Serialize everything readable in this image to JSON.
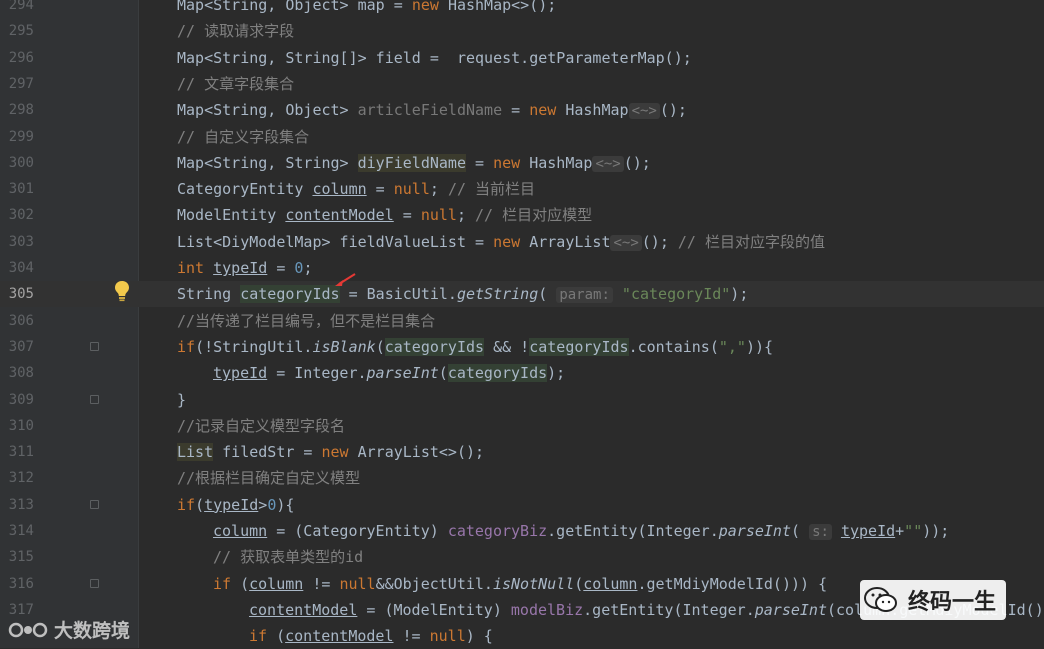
{
  "lines": [
    {
      "n": "294",
      "segs": [
        [
          "",
          "Map<String, Object> map = "
        ],
        [
          "kw",
          "new "
        ],
        [
          "",
          "HashMap<>();"
        ]
      ]
    },
    {
      "n": "295",
      "segs": [
        [
          "cm",
          "// 读取请求字段"
        ]
      ]
    },
    {
      "n": "296",
      "segs": [
        [
          "",
          "Map<String, String[]> field =  request.getParameterMap();"
        ]
      ]
    },
    {
      "n": "297",
      "segs": [
        [
          "cm",
          "// 文章字段集合"
        ]
      ]
    },
    {
      "n": "298",
      "segs": [
        [
          "",
          "Map<String, Object> "
        ],
        [
          "dim",
          "articleFieldName"
        ],
        [
          "",
          " = "
        ],
        [
          "kw",
          "new "
        ],
        [
          "",
          "HashMap"
        ],
        [
          "hint",
          "<~>"
        ],
        [
          "",
          "();"
        ]
      ]
    },
    {
      "n": "299",
      "segs": [
        [
          "cm",
          "// 自定义字段集合"
        ]
      ]
    },
    {
      "n": "300",
      "segs": [
        [
          "",
          "Map<String, String> "
        ],
        [
          "hl2",
          "diyFieldName"
        ],
        [
          "",
          " = "
        ],
        [
          "kw",
          "new "
        ],
        [
          "",
          "HashMap"
        ],
        [
          "hint",
          "<~>"
        ],
        [
          "",
          "();"
        ]
      ]
    },
    {
      "n": "301",
      "segs": [
        [
          "",
          "CategoryEntity "
        ],
        [
          "ul",
          "column"
        ],
        [
          "",
          " = "
        ],
        [
          "kw",
          "null"
        ],
        [
          "",
          "; "
        ],
        [
          "cm",
          "// 当前栏目"
        ]
      ]
    },
    {
      "n": "302",
      "segs": [
        [
          "",
          "ModelEntity "
        ],
        [
          "ul",
          "contentModel"
        ],
        [
          "",
          " = "
        ],
        [
          "kw",
          "null"
        ],
        [
          "",
          "; "
        ],
        [
          "cm",
          "// 栏目对应模型"
        ]
      ]
    },
    {
      "n": "303",
      "segs": [
        [
          "",
          "List<DiyModelMap> fieldValueList = "
        ],
        [
          "kw",
          "new "
        ],
        [
          "",
          "ArrayList"
        ],
        [
          "hint",
          "<~>"
        ],
        [
          "",
          "(); "
        ],
        [
          "cm",
          "// 栏目对应字段的值"
        ]
      ]
    },
    {
      "n": "304",
      "segs": [
        [
          "kw",
          "int "
        ],
        [
          "ul",
          "typeId"
        ],
        [
          "",
          " = "
        ],
        [
          "num",
          "0"
        ],
        [
          "",
          "; "
        ]
      ]
    },
    {
      "n": "305",
      "segs": [
        [
          "",
          "String "
        ],
        [
          "hl",
          "categoryIds"
        ],
        [
          "",
          " = BasicUtil."
        ],
        [
          "it",
          "getString"
        ],
        [
          "",
          "( "
        ],
        [
          "hint",
          "param:"
        ],
        [
          "st",
          " \"categoryId\""
        ],
        [
          "",
          ");"
        ]
      ]
    },
    {
      "n": "306",
      "segs": [
        [
          "cm",
          "//当传递了栏目编号，但不是栏目集合"
        ]
      ]
    },
    {
      "n": "307",
      "segs": [
        [
          "kw",
          "if"
        ],
        [
          "",
          "(!StringUtil."
        ],
        [
          "it",
          "isBlank"
        ],
        [
          "",
          "("
        ],
        [
          "hl",
          "categoryIds"
        ],
        [
          ""
        ],
        [
          "",
          " && !"
        ],
        [
          "hl",
          "categoryIds"
        ],
        [
          "",
          ".contains("
        ],
        [
          "st",
          "\",\""
        ],
        [
          "",
          "))"
        ],
        [
          "",
          "{"
        ]
      ]
    },
    {
      "n": "308",
      "indent": 1,
      "segs": [
        [
          "ul",
          "typeId"
        ],
        [
          "",
          " = Integer."
        ],
        [
          "it",
          "parseInt"
        ],
        [
          "",
          "("
        ],
        [
          "hl",
          "categoryIds"
        ],
        [
          "",
          ");"
        ]
      ]
    },
    {
      "n": "309",
      "segs": [
        [
          "",
          "}"
        ]
      ]
    },
    {
      "n": "310",
      "segs": [
        [
          "cm",
          "//记录自定义模型字段名"
        ]
      ]
    },
    {
      "n": "311",
      "segs": [
        [
          "hl2",
          "List"
        ],
        [
          "",
          " filedStr = "
        ],
        [
          "kw",
          "new "
        ],
        [
          "",
          "ArrayList<>();"
        ]
      ]
    },
    {
      "n": "312",
      "segs": [
        [
          "cm",
          "//根据栏目确定自定义模型"
        ]
      ]
    },
    {
      "n": "313",
      "segs": [
        [
          "kw",
          "if"
        ],
        [
          "",
          "("
        ],
        [
          "ul",
          "typeId"
        ],
        [
          "",
          ">"
        ],
        [
          "num",
          "0"
        ],
        [
          "",
          "){"
        ]
      ]
    },
    {
      "n": "314",
      "indent": 1,
      "segs": [
        [
          "ul",
          "column"
        ],
        [
          "",
          " = (CategoryEntity) "
        ],
        [
          "fld",
          "categoryBiz"
        ],
        [
          "",
          ".getEntity(Integer."
        ],
        [
          "it",
          "parseInt"
        ],
        [
          "",
          "( "
        ],
        [
          "hint",
          "s:"
        ],
        [
          "",
          " "
        ],
        [
          "ul",
          "typeId"
        ],
        [
          "",
          "+"
        ],
        [
          "st",
          "\"\""
        ],
        [
          "",
          "));"
        ]
      ]
    },
    {
      "n": "315",
      "indent": 1,
      "segs": [
        [
          "cm",
          "// 获取表单类型的id"
        ]
      ]
    },
    {
      "n": "316",
      "indent": 1,
      "segs": [
        [
          "kw",
          "if "
        ],
        [
          "",
          "("
        ],
        [
          "ul",
          "column"
        ],
        [
          "",
          " != "
        ],
        [
          "kw",
          "null"
        ],
        [
          "",
          "&&ObjectUtil."
        ],
        [
          "it",
          "isNotNull"
        ],
        [
          "",
          "("
        ],
        [
          "ul",
          "column"
        ],
        [
          "",
          ".getMdiyModelId())) {"
        ]
      ]
    },
    {
      "n": "317",
      "indent": 2,
      "segs": [
        [
          "ul",
          "contentModel"
        ],
        [
          "",
          " = (ModelEntity) "
        ],
        [
          "fld",
          "modelBiz"
        ],
        [
          "",
          ".getEntity(Integer."
        ],
        [
          "it",
          "parseInt"
        ],
        [
          "",
          "(column.getMdiyModelId()"
        ]
      ]
    },
    {
      "n": "",
      "indent": 2,
      "segs": [
        [
          "kw",
          "if "
        ],
        [
          "",
          "("
        ],
        [
          "ul",
          "contentModel"
        ],
        [
          "",
          " != "
        ],
        [
          "kw",
          "null"
        ],
        [
          "",
          ") {"
        ]
      ]
    }
  ],
  "current_line": "305",
  "fold_lines": [
    "307",
    "309",
    "313",
    "316"
  ],
  "bulb_icon": "lightbulb-icon",
  "watermark": {
    "text": "大数跨境"
  },
  "wechat_badge": {
    "text": "终码一生"
  }
}
